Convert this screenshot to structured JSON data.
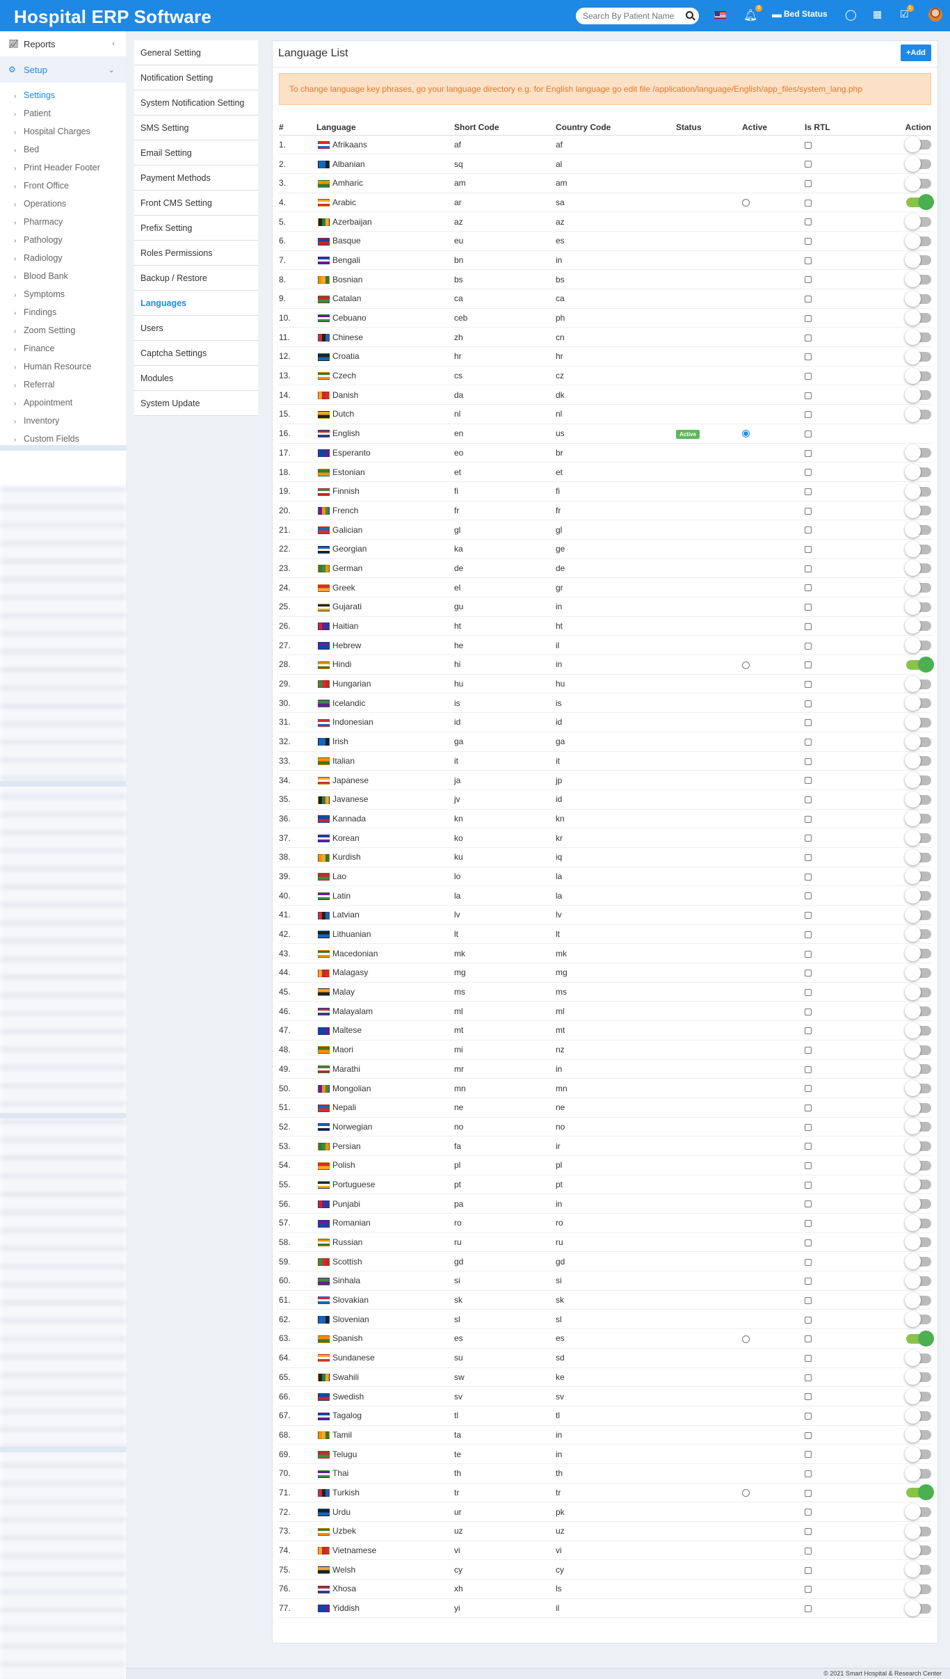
{
  "header": {
    "brand": "Hospital ERP Software",
    "search_placeholder": "Search By Patient Name",
    "notif_count": "6",
    "task_count": "1",
    "bed_status": "Bed Status"
  },
  "sidebar": {
    "reports": "Reports",
    "setup": "Setup",
    "items": [
      "Settings",
      "Patient",
      "Hospital Charges",
      "Bed",
      "Print Header Footer",
      "Front Office",
      "Operations",
      "Pharmacy",
      "Pathology",
      "Radiology",
      "Blood Bank",
      "Symptoms",
      "Findings",
      "Zoom Setting",
      "Finance",
      "Human Resource",
      "Referral",
      "Appointment",
      "Inventory",
      "Custom Fields"
    ]
  },
  "settings_menu": [
    "General Setting",
    "Notification Setting",
    "System Notification Setting",
    "SMS Setting",
    "Email Setting",
    "Payment Methods",
    "Front CMS Setting",
    "Prefix Setting",
    "Roles Permissions",
    "Backup / Restore",
    "Languages",
    "Users",
    "Captcha Settings",
    "Modules",
    "System Update"
  ],
  "panel": {
    "title": "Language List",
    "add_label": "Add",
    "notice": "To change language key phrases, go your language directory e.g. for English language go edit file /application/language/English/app_files/system_lang.php",
    "columns": [
      "#",
      "Language",
      "Short Code",
      "Country Code",
      "Status",
      "Active",
      "Is RTL",
      "Action"
    ],
    "active_badge": "Active",
    "languages": [
      [
        "1.",
        "Afrikaans",
        "af",
        "af"
      ],
      [
        "2.",
        "Albanian",
        "sq",
        "al"
      ],
      [
        "3.",
        "Amharic",
        "am",
        "am"
      ],
      [
        "4.",
        "Arabic",
        "ar",
        "sa"
      ],
      [
        "5.",
        "Azerbaijan",
        "az",
        "az"
      ],
      [
        "6.",
        "Basque",
        "eu",
        "es"
      ],
      [
        "7.",
        "Bengali",
        "bn",
        "in"
      ],
      [
        "8.",
        "Bosnian",
        "bs",
        "bs"
      ],
      [
        "9.",
        "Catalan",
        "ca",
        "ca"
      ],
      [
        "10.",
        "Cebuano",
        "ceb",
        "ph"
      ],
      [
        "11.",
        "Chinese",
        "zh",
        "cn"
      ],
      [
        "12.",
        "Croatia",
        "hr",
        "hr"
      ],
      [
        "13.",
        "Czech",
        "cs",
        "cz"
      ],
      [
        "14.",
        "Danish",
        "da",
        "dk"
      ],
      [
        "15.",
        "Dutch",
        "nl",
        "nl"
      ],
      [
        "16.",
        "English",
        "en",
        "us"
      ],
      [
        "17.",
        "Esperanto",
        "eo",
        "br"
      ],
      [
        "18.",
        "Estonian",
        "et",
        "et"
      ],
      [
        "19.",
        "Finnish",
        "fi",
        "fi"
      ],
      [
        "20.",
        "French",
        "fr",
        "fr"
      ],
      [
        "21.",
        "Galician",
        "gl",
        "gl"
      ],
      [
        "22.",
        "Georgian",
        "ka",
        "ge"
      ],
      [
        "23.",
        "German",
        "de",
        "de"
      ],
      [
        "24.",
        "Greek",
        "el",
        "gr"
      ],
      [
        "25.",
        "Gujarati",
        "gu",
        "in"
      ],
      [
        "26.",
        "Haitian",
        "ht",
        "ht"
      ],
      [
        "27.",
        "Hebrew",
        "he",
        "il"
      ],
      [
        "28.",
        "Hindi",
        "hi",
        "in"
      ],
      [
        "29.",
        "Hungarian",
        "hu",
        "hu"
      ],
      [
        "30.",
        "Icelandic",
        "is",
        "is"
      ],
      [
        "31.",
        "Indonesian",
        "id",
        "id"
      ],
      [
        "32.",
        "Irish",
        "ga",
        "ga"
      ],
      [
        "33.",
        "Italian",
        "it",
        "it"
      ],
      [
        "34.",
        "Japanese",
        "ja",
        "jp"
      ],
      [
        "35.",
        "Javanese",
        "jv",
        "id"
      ],
      [
        "36.",
        "Kannada",
        "kn",
        "kn"
      ],
      [
        "37.",
        "Korean",
        "ko",
        "kr"
      ],
      [
        "38.",
        "Kurdish",
        "ku",
        "iq"
      ],
      [
        "39.",
        "Lao",
        "lo",
        "la"
      ],
      [
        "40.",
        "Latin",
        "la",
        "la"
      ],
      [
        "41.",
        "Latvian",
        "lv",
        "lv"
      ],
      [
        "42.",
        "Lithuanian",
        "lt",
        "lt"
      ],
      [
        "43.",
        "Macedonian",
        "mk",
        "mk"
      ],
      [
        "44.",
        "Malagasy",
        "mg",
        "mg"
      ],
      [
        "45.",
        "Malay",
        "ms",
        "ms"
      ],
      [
        "46.",
        "Malayalam",
        "ml",
        "ml"
      ],
      [
        "47.",
        "Maltese",
        "mt",
        "mt"
      ],
      [
        "48.",
        "Maori",
        "mi",
        "nz"
      ],
      [
        "49.",
        "Marathi",
        "mr",
        "in"
      ],
      [
        "50.",
        "Mongolian",
        "mn",
        "mn"
      ],
      [
        "51.",
        "Nepali",
        "ne",
        "ne"
      ],
      [
        "52.",
        "Norwegian",
        "no",
        "no"
      ],
      [
        "53.",
        "Persian",
        "fa",
        "ir"
      ],
      [
        "54.",
        "Polish",
        "pl",
        "pl"
      ],
      [
        "55.",
        "Portuguese",
        "pt",
        "pt"
      ],
      [
        "56.",
        "Punjabi",
        "pa",
        "in"
      ],
      [
        "57.",
        "Romanian",
        "ro",
        "ro"
      ],
      [
        "58.",
        "Russian",
        "ru",
        "ru"
      ],
      [
        "59.",
        "Scottish",
        "gd",
        "gd"
      ],
      [
        "60.",
        "Sinhala",
        "si",
        "si"
      ],
      [
        "61.",
        "Slovakian",
        "sk",
        "sk"
      ],
      [
        "62.",
        "Slovenian",
        "sl",
        "sl"
      ],
      [
        "63.",
        "Spanish",
        "es",
        "es"
      ],
      [
        "64.",
        "Sundanese",
        "su",
        "sd"
      ],
      [
        "65.",
        "Swahili",
        "sw",
        "ke"
      ],
      [
        "66.",
        "Swedish",
        "sv",
        "sv"
      ],
      [
        "67.",
        "Tagalog",
        "tl",
        "tl"
      ],
      [
        "68.",
        "Tamil",
        "ta",
        "in"
      ],
      [
        "69.",
        "Telugu",
        "te",
        "in"
      ],
      [
        "70.",
        "Thai",
        "th",
        "th"
      ],
      [
        "71.",
        "Turkish",
        "tr",
        "tr"
      ],
      [
        "72.",
        "Urdu",
        "ur",
        "pk"
      ],
      [
        "73.",
        "Uzbek",
        "uz",
        "uz"
      ],
      [
        "74.",
        "Vietnamese",
        "vi",
        "vi"
      ],
      [
        "75.",
        "Welsh",
        "cy",
        "cy"
      ],
      [
        "76.",
        "Xhosa",
        "xh",
        "ls"
      ],
      [
        "77.",
        "Yiddish",
        "yi",
        "il"
      ]
    ],
    "enabled_rows": [
      4,
      28,
      63,
      71
    ],
    "current_row": 16
  },
  "footer": "© 2021 Smart Hospital & Research Center",
  "colors": {
    "primary": "#1e88e5",
    "toggle_on": "#4caf50",
    "notice_bg": "#fce1c6",
    "notice_text": "#e8772a"
  }
}
